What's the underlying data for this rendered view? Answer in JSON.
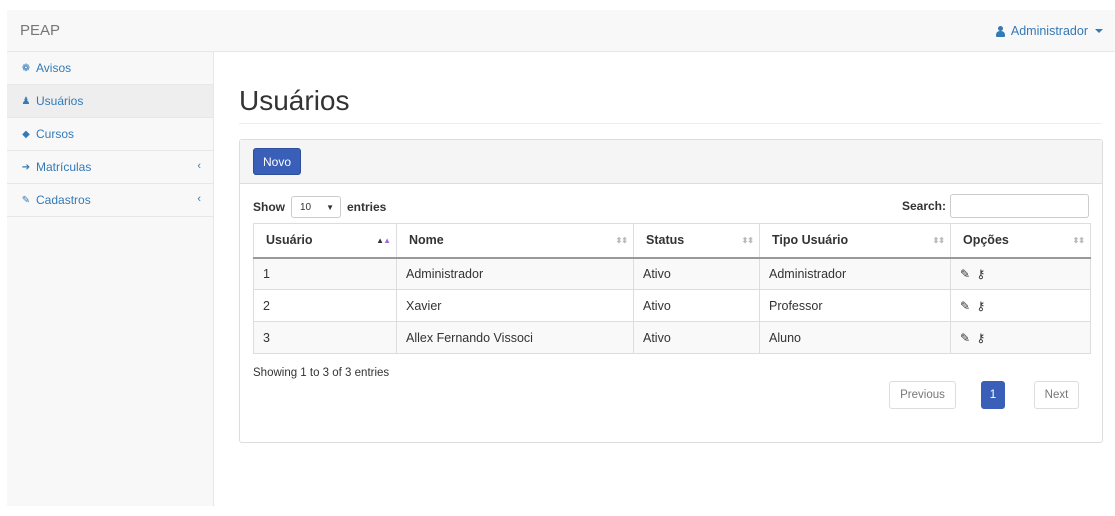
{
  "navbar": {
    "brand": "PEAP",
    "user_label": "Administrador"
  },
  "sidebar": {
    "items": [
      {
        "label": "Avisos",
        "icon": "dashboard-icon"
      },
      {
        "label": "Usuários",
        "icon": "user-icon"
      },
      {
        "label": "Cursos",
        "icon": "graduation-cap-icon"
      },
      {
        "label": "Matrículas",
        "icon": "sign-in-icon"
      },
      {
        "label": "Cadastros",
        "icon": "edit-icon"
      }
    ]
  },
  "main": {
    "title": "Usuários",
    "new_button": "Novo",
    "length": {
      "show": "Show",
      "value": "10",
      "entries": "entries"
    },
    "search_label": "Search:",
    "columns": [
      "Usuário",
      "Nome",
      "Status",
      "Tipo Usuário",
      "Opções"
    ],
    "rows": [
      {
        "id": "1",
        "nome": "Administrador",
        "status": "Ativo",
        "tipo": "Administrador"
      },
      {
        "id": "2",
        "nome": "Xavier",
        "status": "Ativo",
        "tipo": "Professor"
      },
      {
        "id": "3",
        "nome": "Allex Fernando Vissoci",
        "status": "Ativo",
        "tipo": "Aluno"
      }
    ],
    "info": "Showing 1 to 3 of 3 entries",
    "pagination": {
      "previous": "Previous",
      "current": "1",
      "next": "Next"
    }
  },
  "colors": {
    "accent": "#3a5fb8",
    "link": "#337ab7"
  }
}
